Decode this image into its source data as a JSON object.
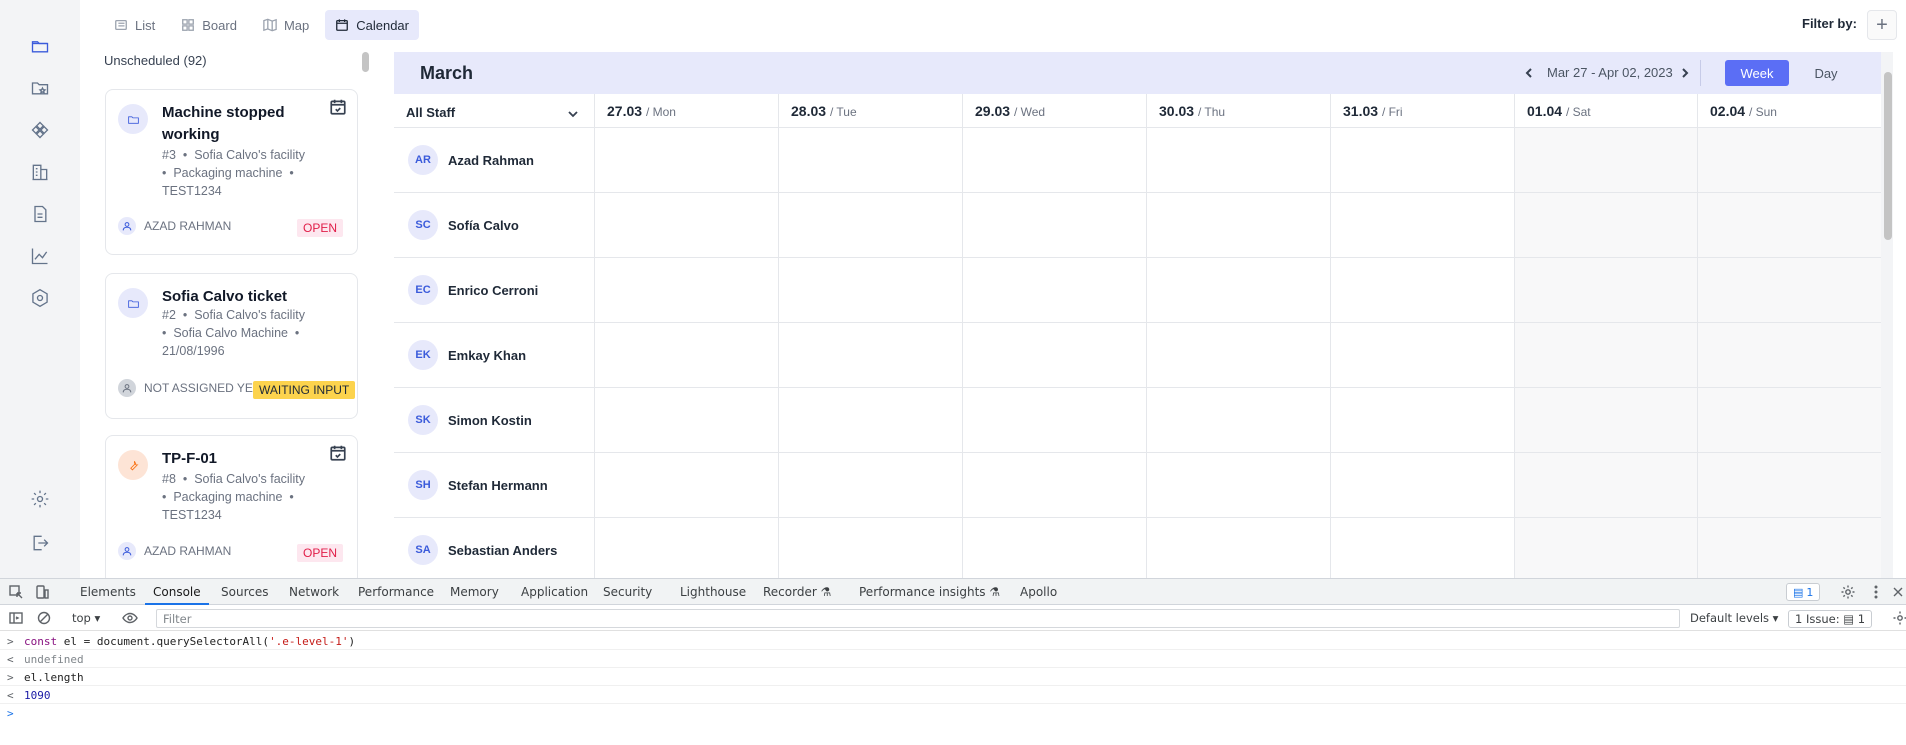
{
  "tabs": [
    {
      "label": "List",
      "icon": "list-icon"
    },
    {
      "label": "Board",
      "icon": "board-icon"
    },
    {
      "label": "Map",
      "icon": "map-icon"
    },
    {
      "label": "Calendar",
      "icon": "calendar-icon",
      "active": true
    }
  ],
  "filter": {
    "label": "Filter by:",
    "add": "+"
  },
  "unscheduled": {
    "title": "Unscheduled (92)",
    "cards": [
      {
        "title": "Machine stopped working",
        "meta": [
          "#3",
          "Sofia Calvo's facility",
          "Packaging machine",
          "TEST1234"
        ],
        "assignee": "AZAD RAHMAN",
        "status": "OPEN"
      },
      {
        "title": "Sofia Calvo ticket",
        "meta": [
          "#2",
          "Sofia Calvo's facility",
          "Sofia Calvo Machine",
          "21/08/1996"
        ],
        "assignee": "NOT ASSIGNED YET",
        "status": "WAITING INPUT"
      },
      {
        "title": "TP-F-01",
        "meta": [
          "#8",
          "Sofia Calvo's facility",
          "Packaging machine",
          "TEST1234"
        ],
        "assignee": "AZAD RAHMAN",
        "status": "OPEN"
      }
    ]
  },
  "calendar": {
    "month": "March",
    "range": "Mar 27 - Apr 02, 2023",
    "view_week": "Week",
    "view_day": "Day",
    "staff_filter": "All Staff",
    "days": [
      {
        "date": "27.03",
        "name": "/ Mon"
      },
      {
        "date": "28.03",
        "name": "/ Tue"
      },
      {
        "date": "29.03",
        "name": "/ Wed"
      },
      {
        "date": "30.03",
        "name": "/ Thu"
      },
      {
        "date": "31.03",
        "name": "/ Fri"
      },
      {
        "date": "01.04",
        "name": "/ Sat"
      },
      {
        "date": "02.04",
        "name": "/ Sun"
      }
    ],
    "staff": [
      {
        "initials": "AR",
        "name": "Azad Rahman"
      },
      {
        "initials": "SC",
        "name": "Sofía Calvo"
      },
      {
        "initials": "EC",
        "name": "Enrico Cerroni"
      },
      {
        "initials": "EK",
        "name": "Emkay Khan"
      },
      {
        "initials": "SK",
        "name": "Simon Kostin"
      },
      {
        "initials": "SH",
        "name": "Stefan Hermann"
      },
      {
        "initials": "SA",
        "name": "Sebastian Anders"
      }
    ]
  },
  "devtools": {
    "tabs": [
      "Elements",
      "Console",
      "Sources",
      "Network",
      "Performance",
      "Memory",
      "Application",
      "Security",
      "Lighthouse",
      "Recorder ⚗",
      "Performance insights ⚗",
      "Apollo"
    ],
    "active_tab": "Console",
    "issue_count": "1",
    "context": "top",
    "filter_placeholder": "Filter",
    "levels": "Default levels ▾",
    "issues": "1 Issue: ▤ 1",
    "console": [
      {
        "prefix": ">",
        "code": "const el = document.querySelectorAll('.e-level-1')"
      },
      {
        "prefix": "<",
        "code": "undefined"
      },
      {
        "prefix": ">",
        "code": "el.length"
      },
      {
        "prefix": "<",
        "code": "1090"
      },
      {
        "prefix": ">",
        "code": ""
      }
    ]
  },
  "colors": {
    "accent": "#5b6ef5",
    "calendar_header": "#e7e9fb",
    "open_badge": "#e11d48",
    "waiting_badge": "#fcd34d"
  }
}
